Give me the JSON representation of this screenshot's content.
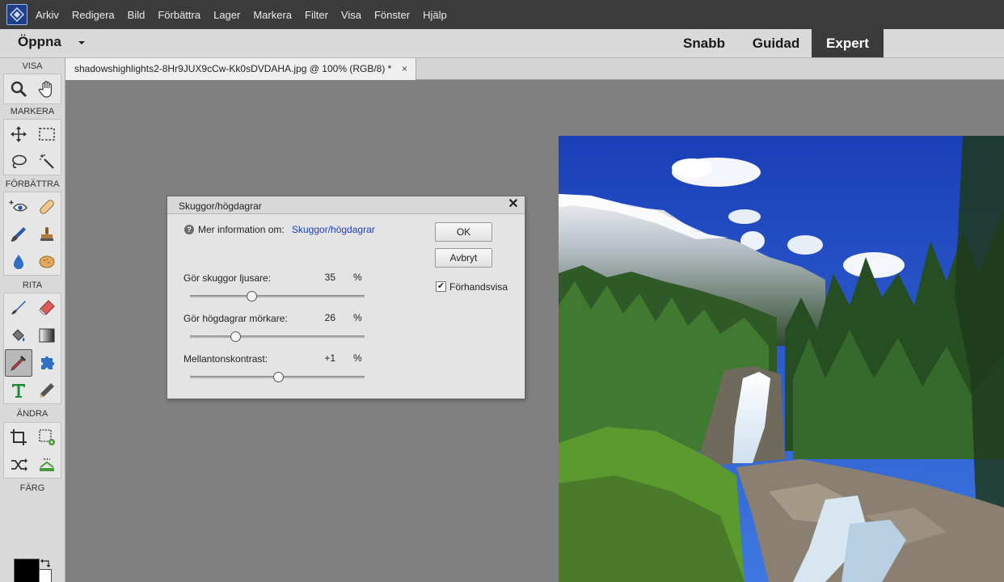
{
  "menu": {
    "items": [
      "Arkiv",
      "Redigera",
      "Bild",
      "Förbättra",
      "Lager",
      "Markera",
      "Filter",
      "Visa",
      "Fönster",
      "Hjälp"
    ]
  },
  "modebar": {
    "open_label": "Öppna",
    "modes": [
      "Snabb",
      "Guidad",
      "Expert"
    ],
    "active_mode": "Expert"
  },
  "toolbox": {
    "sections": [
      "VISA",
      "MARKERA",
      "FÖRBÄTTRA",
      "RITA",
      "ÄNDRA",
      "FÄRG"
    ],
    "selected_tool": "eyedropper-tool",
    "foreground_color": "#000000",
    "background_color": "#ffffff"
  },
  "document": {
    "tab_title": "shadowshighlights2-8Hr9JUX9cCw-Kk0sDVDAHA.jpg @ 100% (RGB/8) *",
    "close_glyph": "×"
  },
  "dialog": {
    "title": "Skuggor/högdagrar",
    "help_prefix": "Mer information om:",
    "help_link": "Skuggor/högdagrar",
    "ok_label": "OK",
    "cancel_label": "Avbryt",
    "preview_label": "Förhandsvisa",
    "preview_checked": true,
    "sliders": [
      {
        "label": "Gör skuggor ljusare:",
        "value": "35",
        "unit": "%",
        "position": 0.35
      },
      {
        "label": "Gör högdagrar mörkare:",
        "value": "26",
        "unit": "%",
        "position": 0.26
      },
      {
        "label": "Mellantonskontrast:",
        "value": "+1",
        "unit": "%",
        "position": 0.505
      }
    ]
  }
}
